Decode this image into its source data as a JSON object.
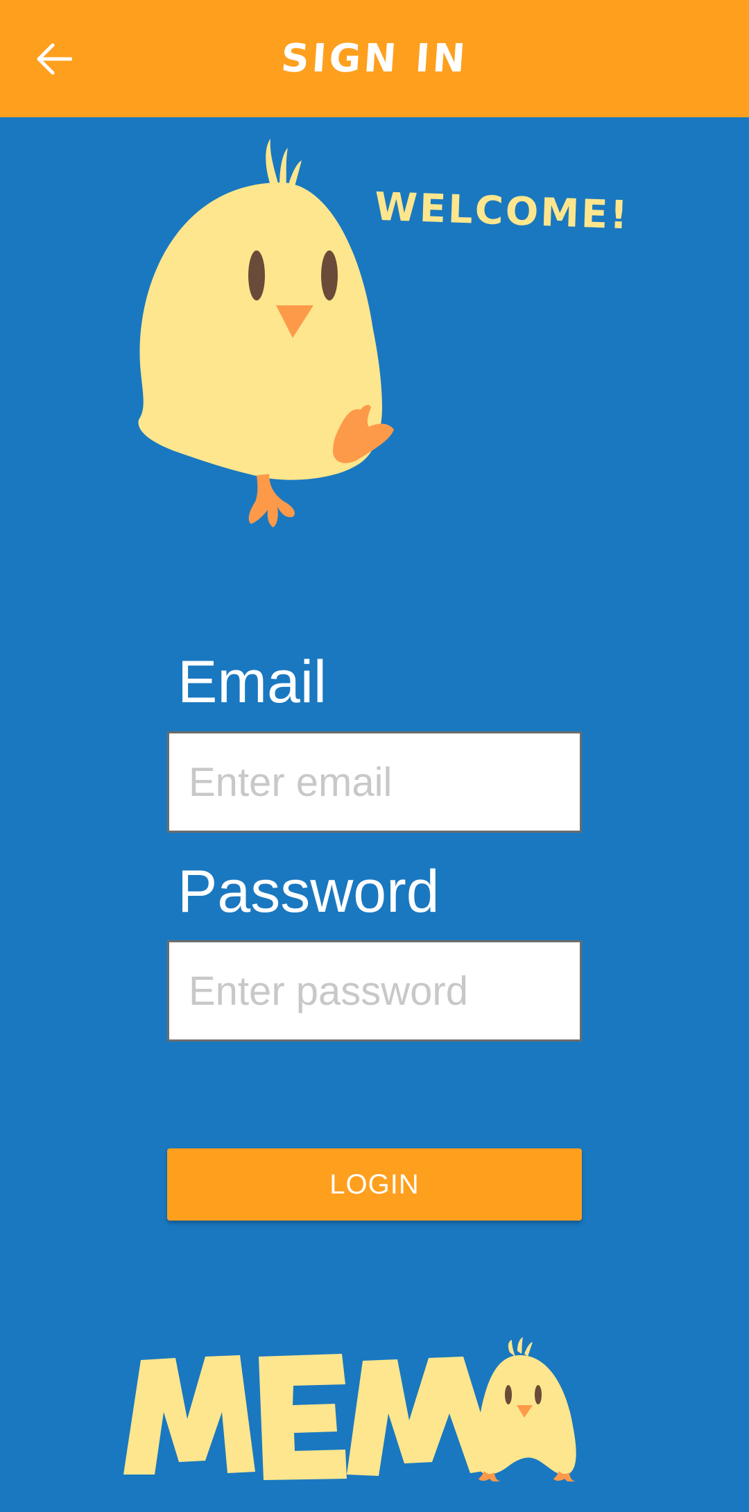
{
  "app_bar": {
    "title": "SIGN IN",
    "back_icon": "arrow-left-icon"
  },
  "hero": {
    "welcome_text": "WELCOME!",
    "mascot": "chick-mascot"
  },
  "form": {
    "email_label": "Email",
    "email_placeholder": "Enter email",
    "email_value": "",
    "password_label": "Password",
    "password_placeholder": "Enter password",
    "password_value": "",
    "login_label": "LOGIN"
  },
  "logo": {
    "text": "MEMA"
  },
  "colors": {
    "background": "#1a78c0",
    "app_bar": "#fe9f1e",
    "accent_yellow": "#fde68d",
    "button": "#fe9f1e"
  }
}
